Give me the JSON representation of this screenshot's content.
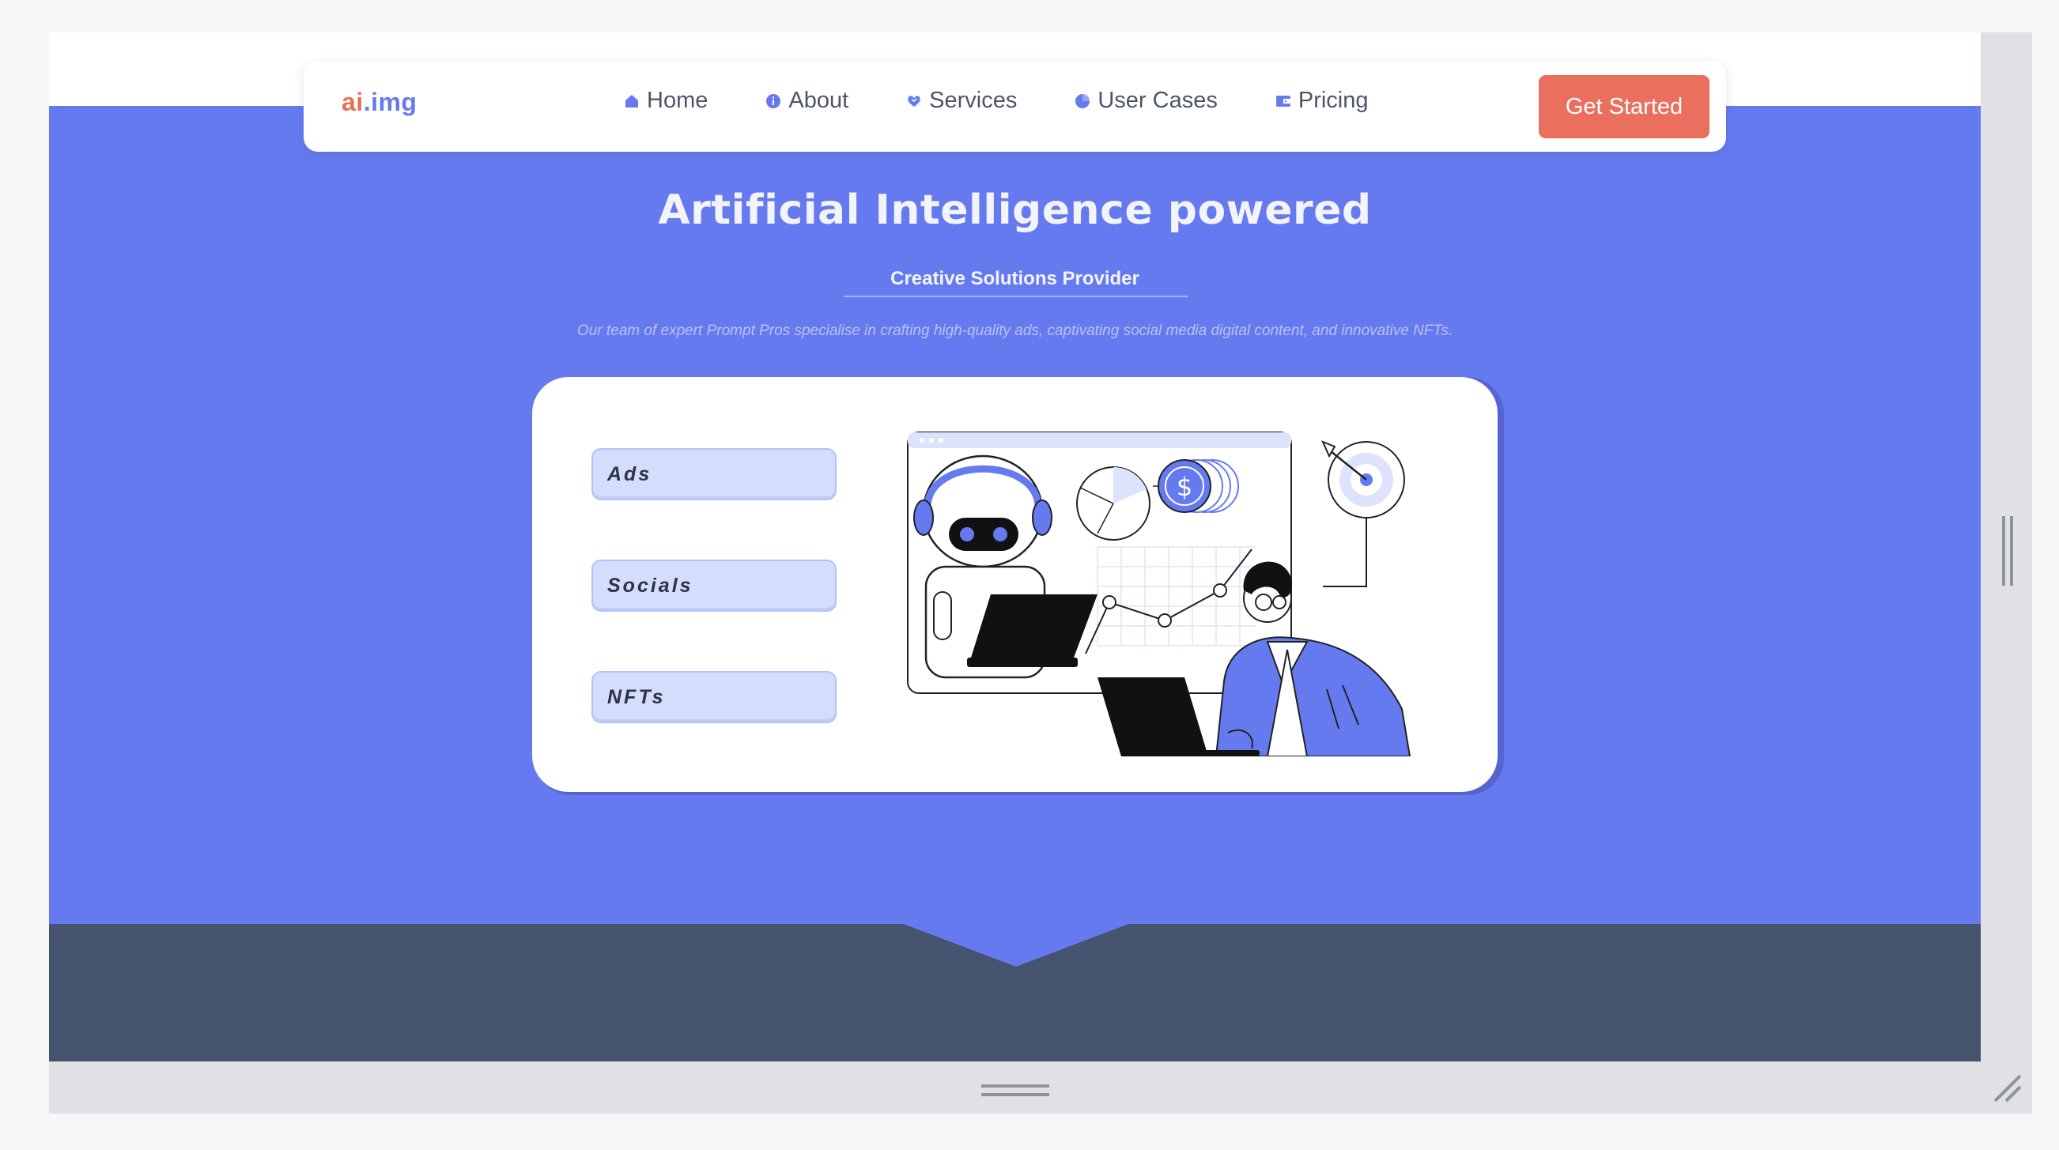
{
  "brand": {
    "logo_part1": "ai",
    "logo_part2": ".img"
  },
  "nav": {
    "items": [
      {
        "label": "Home",
        "icon": "home-icon"
      },
      {
        "label": "About",
        "icon": "info-icon"
      },
      {
        "label": "Services",
        "icon": "services-icon"
      },
      {
        "label": "User Cases",
        "icon": "pie-chart-icon"
      },
      {
        "label": "Pricing",
        "icon": "wallet-icon"
      }
    ],
    "cta_label": "Get Started"
  },
  "hero": {
    "title": "Artificial Intelligence powered",
    "subtitle": "Creative Solutions Provider",
    "description": "Our team of expert Prompt Pros specialise in crafting high-quality ads, captivating social media digital content, and innovative NFTs."
  },
  "services": [
    {
      "label": "Ads"
    },
    {
      "label": "Socials"
    },
    {
      "label": "NFTs"
    }
  ],
  "illustration": {
    "icon": "ai-robot-analytics-illustration",
    "currency_symbol": "$"
  },
  "colors": {
    "accent": "#667aef",
    "cta": "#ea6f5e",
    "footer_band": "#46536e",
    "pill_bg": "#d5ddfc"
  }
}
